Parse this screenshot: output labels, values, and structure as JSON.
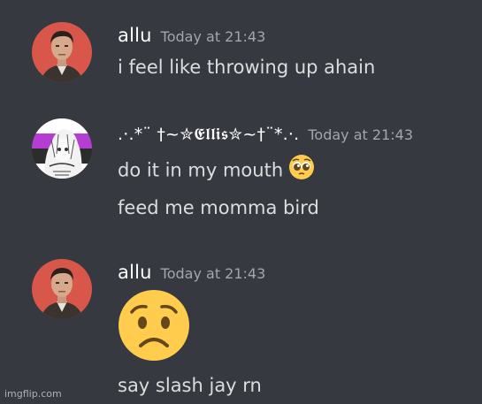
{
  "messages": [
    {
      "author": "allu",
      "timestamp": "Today at 21:43",
      "avatar_icon": "man-portrait-avatar",
      "lines": [
        "i feel like throwing up ahain"
      ]
    },
    {
      "author": ".·.*¨ †~✮𝕰𝖑𝖑𝖎𝖘✮~†¨*.·.",
      "timestamp": "Today at 21:43",
      "avatar_icon": "anime-girl-flag-avatar",
      "lines": [
        "do it in my mouth",
        "feed me momma bird"
      ],
      "inline_emoji": "pleading-face-emoji"
    },
    {
      "author": "allu",
      "timestamp": "Today at 21:43",
      "avatar_icon": "man-portrait-avatar",
      "big_emoji": "worried-face-emoji",
      "lines": [
        "say slash jay rn"
      ]
    }
  ],
  "watermark": "imgflip.com",
  "colors": {
    "background": "#36393f",
    "username": "#ffffff",
    "message_text": "#dcddde",
    "timestamp": "#a3a6aa",
    "emoji_yellow": "#ffcc4d"
  }
}
